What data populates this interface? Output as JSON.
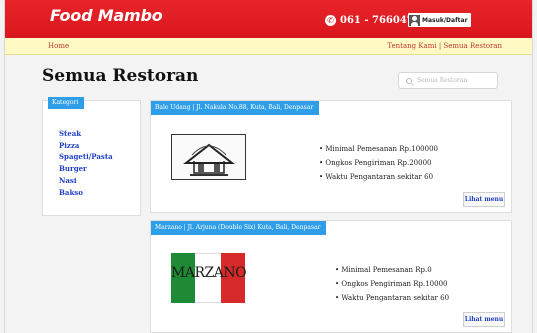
{
  "header": {
    "logo": "Food Mambo",
    "phone": "061 - 76604717",
    "login_label": "Masuk/Daftar"
  },
  "nav": {
    "home": "Home",
    "right_links": "Tentang Kami | Semua Restoran"
  },
  "page": {
    "title": "Semua Restoran",
    "search_placeholder": "Semua Restoran"
  },
  "sidebar": {
    "title": "Kategori",
    "categories": [
      "Steak",
      "Pizza",
      "Spageti/Pasta",
      "Burger",
      "Nasi",
      "Bakso"
    ]
  },
  "restaurants": [
    {
      "header": "Bale Udang | Jl. Nakula No.88, Kuta, Bali, Denpasar",
      "info": [
        "Minimal Pemesanan Rp.100000",
        "Ongkos Pengiriman Rp.20000",
        "Waktu Pengantaran sekitar 60"
      ],
      "button": "Lihat menu"
    },
    {
      "header": "Marzano | Jl. Arjuna (Double Six) Kuta, Bali, Denpasar",
      "logo_text": "MARZANO",
      "info": [
        "Minimal Pemesanan Rp.0",
        "Ongkos Pengiriman Rp.10000",
        "Waktu Pengantaran sekitar 60"
      ],
      "button": "Lihat menu"
    }
  ]
}
